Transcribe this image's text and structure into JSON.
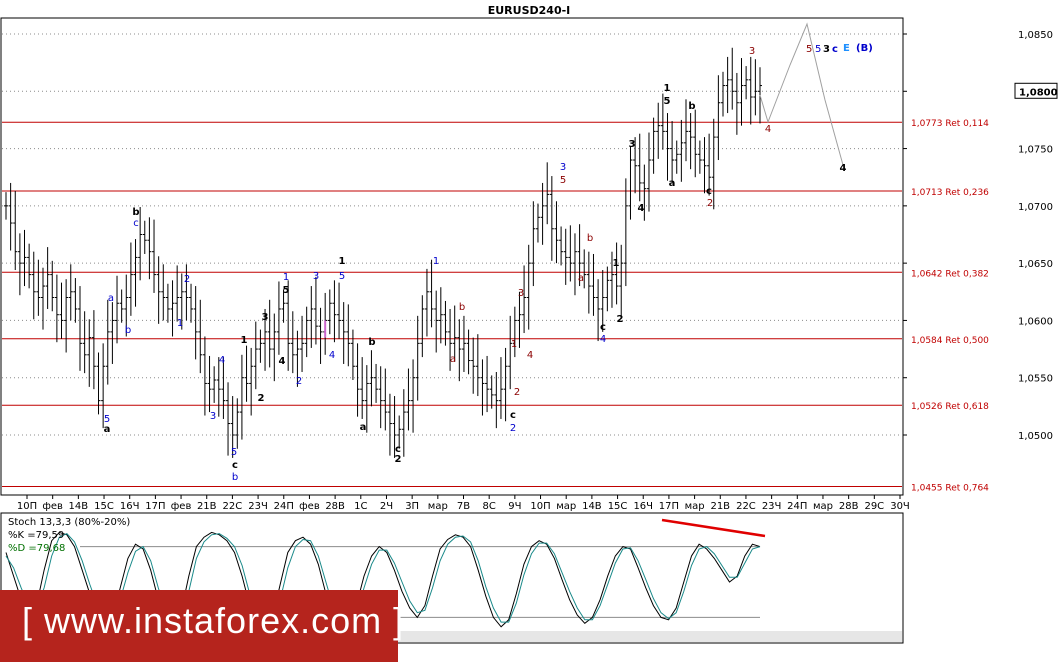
{
  "window": {
    "title": "EURUSD240-I"
  },
  "chart_data": [
    {
      "type": "line",
      "title": "EURUSD240-I",
      "ylim": [
        1.0435,
        1.0865
      ],
      "y_ticks": [
        "1,0850",
        "1,0800",
        "1,0750",
        "1,0700",
        "1,0650",
        "1,0600",
        "1,0550",
        "1,0500"
      ],
      "current_price": "1,0800",
      "x_ticks": [
        "10П",
        "фев",
        "14В",
        "15С",
        "16Ч",
        "17П",
        "фев",
        "21В",
        "22С",
        "23Ч",
        "24П",
        "фев",
        "28В",
        "1С",
        "2Ч",
        "3П",
        "мар",
        "7В",
        "8С",
        "9Ч",
        "10П",
        "мар",
        "14В",
        "15С",
        "16Ч",
        "17П",
        "мар",
        "21В",
        "22С",
        "23Ч",
        "24П",
        "мар",
        "28В",
        "29С",
        "30Ч"
      ],
      "retracements": [
        {
          "price": 1.0773,
          "label": "1,0773 Ret 0,114"
        },
        {
          "price": 1.0713,
          "label": "1,0713 Ret 0,236"
        },
        {
          "price": 1.0642,
          "label": "1,0642 Ret 0,382"
        },
        {
          "price": 1.0584,
          "label": "1,0584 Ret 0,500"
        },
        {
          "price": 1.0526,
          "label": "1,0526 Ret 0,618"
        },
        {
          "price": 1.0455,
          "label": "1,0455 Ret 0,764"
        }
      ],
      "series": [
        {
          "values": [
            1.07,
            1.0685,
            1.066,
            1.065,
            1.0655,
            1.064,
            1.0625,
            1.062,
            1.063,
            1.064,
            1.062,
            1.0605,
            1.06,
            1.062,
            1.0625,
            1.061,
            1.058,
            1.057,
            1.0585,
            1.056,
            1.053,
            1.056,
            1.059,
            1.06,
            1.0615,
            1.061,
            1.062,
            1.064,
            1.0655,
            1.0675,
            1.067,
            1.066,
            1.064,
            1.0625,
            1.062,
            1.061,
            1.0615,
            1.062,
            1.0625,
            1.062,
            1.061,
            1.059,
            1.057,
            1.0545,
            1.054,
            1.0548,
            1.054,
            1.053,
            1.051,
            1.05,
            1.052,
            1.055,
            1.0545,
            1.056,
            1.0575,
            1.058,
            1.059,
            1.0575,
            1.059,
            1.061,
            1.0615,
            1.058,
            1.057,
            1.0575,
            1.058,
            1.06,
            1.061,
            1.0595,
            1.059,
            1.06,
            1.0615,
            1.0605,
            1.06,
            1.059,
            1.058,
            1.056,
            1.054,
            1.053,
            1.0545,
            1.055,
            1.054,
            1.053,
            1.052,
            1.051,
            1.05,
            1.0505,
            1.052,
            1.053,
            1.055,
            1.058,
            1.061,
            1.0625,
            1.061,
            1.06,
            1.0605,
            1.059,
            1.058,
            1.0585,
            1.0575,
            1.058,
            1.0565,
            1.056,
            1.055,
            1.0545,
            1.054,
            1.0535,
            1.053,
            1.054,
            1.056,
            1.058,
            1.06,
            1.0605,
            1.062,
            1.065,
            1.068,
            1.069,
            1.07,
            1.071,
            1.068,
            1.067,
            1.066,
            1.0655,
            1.065,
            1.066,
            1.065,
            1.064,
            1.063,
            1.062,
            1.061,
            1.062,
            1.0635,
            1.064,
            1.063,
            1.065,
            1.07,
            1.074,
            1.0735,
            1.072,
            1.0715,
            1.074,
            1.0765,
            1.077,
            1.0765,
            1.075,
            1.074,
            1.0745,
            1.0755,
            1.0765,
            1.076,
            1.0745,
            1.074,
            1.0735,
            1.0725,
            1.076,
            1.079,
            1.0805,
            1.081,
            1.08,
            1.079,
            1.0805,
            1.081,
            1.0795,
            1.08,
            1.0805
          ]
        },
        {
          "name": "%K",
          "values": [
            75,
            55,
            35,
            22,
            30,
            60,
            85,
            92,
            90,
            80,
            60,
            40,
            25,
            15,
            20,
            45,
            70,
            82,
            78,
            60,
            35,
            18,
            12,
            25,
            55,
            80,
            88,
            92,
            90,
            85,
            75,
            55,
            30,
            15,
            10,
            20,
            48,
            75,
            85,
            88,
            82,
            65,
            40,
            18,
            8,
            12,
            30,
            55,
            72,
            80,
            75,
            60,
            42,
            28,
            20,
            30,
            55,
            78,
            86,
            90,
            88,
            80,
            60,
            38,
            20,
            12,
            18,
            40,
            65,
            80,
            85,
            82,
            70,
            52,
            35,
            22,
            15,
            20,
            35,
            55,
            72,
            80,
            78,
            62,
            45,
            30,
            20,
            18,
            28,
            50,
            72,
            82,
            78,
            70,
            60,
            50,
            55,
            72,
            82,
            80
          ]
        },
        {
          "name": "%D",
          "values": [
            72,
            62,
            45,
            30,
            28,
            45,
            72,
            88,
            91,
            84,
            68,
            48,
            30,
            18,
            18,
            35,
            58,
            76,
            80,
            68,
            45,
            25,
            14,
            20,
            42,
            70,
            84,
            90,
            91,
            87,
            80,
            64,
            40,
            22,
            12,
            16,
            35,
            62,
            80,
            86,
            85,
            72,
            50,
            28,
            12,
            10,
            22,
            45,
            65,
            77,
            77,
            66,
            50,
            34,
            24,
            26,
            45,
            68,
            82,
            88,
            89,
            84,
            68,
            46,
            28,
            16,
            16,
            32,
            56,
            74,
            83,
            83,
            74,
            58,
            42,
            28,
            18,
            18,
            30,
            48,
            66,
            78,
            79,
            68,
            52,
            36,
            24,
            19,
            24,
            42,
            64,
            78,
            80,
            74,
            64,
            54,
            54,
            66,
            78,
            80
          ]
        }
      ]
    }
  ],
  "indicator": {
    "title": "Stoch 13,3,3 (80%-20%)",
    "k_label": "%K =79,59",
    "d_label": "%D =79,68"
  },
  "waves": [
    {
      "t": "b",
      "c": "#000000",
      "i": [
        136,
        215
      ]
    },
    {
      "t": "c",
      "c": "#0000cc",
      "i": [
        136,
        226
      ]
    },
    {
      "t": "a",
      "c": "#0000cc",
      "i": [
        111,
        301
      ]
    },
    {
      "t": "b",
      "c": "#0000cc",
      "i": [
        128,
        333
      ]
    },
    {
      "t": "2",
      "c": "#0000cc",
      "i": [
        187,
        282
      ]
    },
    {
      "t": "1",
      "c": "#0000cc",
      "i": [
        180,
        326
      ]
    },
    {
      "t": "5",
      "c": "#0000cc",
      "i": [
        107,
        422
      ]
    },
    {
      "t": "a",
      "c": "#000000",
      "i": [
        107,
        432
      ]
    },
    {
      "t": "3",
      "c": "#0000cc",
      "i": [
        213,
        419
      ]
    },
    {
      "t": "4",
      "c": "#0000cc",
      "i": [
        222,
        363
      ]
    },
    {
      "t": "5",
      "c": "#0000cc",
      "i": [
        234,
        455
      ]
    },
    {
      "t": "c",
      "c": "#000000",
      "i": [
        235,
        468
      ]
    },
    {
      "t": "b",
      "c": "#0000cc",
      "i": [
        235,
        480
      ]
    },
    {
      "t": "1",
      "c": "#000000",
      "i": [
        244,
        343
      ]
    },
    {
      "t": "2",
      "c": "#000000",
      "i": [
        261,
        401
      ]
    },
    {
      "t": "3",
      "c": "#000000",
      "i": [
        265,
        320
      ]
    },
    {
      "t": "4",
      "c": "#000000",
      "i": [
        282,
        364
      ]
    },
    {
      "t": "1",
      "c": "#0000cc",
      "i": [
        286,
        280
      ]
    },
    {
      "t": "5",
      "c": "#000000",
      "i": [
        286,
        293
      ]
    },
    {
      "t": "2",
      "c": "#0000cc",
      "i": [
        299,
        384
      ]
    },
    {
      "t": "3",
      "c": "#0000cc",
      "i": [
        316,
        279
      ]
    },
    {
      "t": "4",
      "c": "#0000cc",
      "i": [
        332,
        358
      ]
    },
    {
      "t": "1",
      "c": "#000000",
      "i": [
        342,
        264
      ]
    },
    {
      "t": "5",
      "c": "#0000cc",
      "i": [
        342,
        279
      ]
    },
    {
      "t": "b",
      "c": "#000000",
      "i": [
        372,
        345
      ]
    },
    {
      "t": "a",
      "c": "#000000",
      "i": [
        363,
        430
      ]
    },
    {
      "t": "c",
      "c": "#000000",
      "i": [
        398,
        452
      ]
    },
    {
      "t": "2",
      "c": "#000000",
      "i": [
        398,
        462
      ]
    },
    {
      "t": "1",
      "c": "#0000cc",
      "i": [
        436,
        264
      ]
    },
    {
      "t": "b",
      "c": "#8b0000",
      "i": [
        462,
        310
      ]
    },
    {
      "t": "a",
      "c": "#8b0000",
      "i": [
        453,
        362
      ]
    },
    {
      "t": "3",
      "c": "#8b0000",
      "i": [
        521,
        296
      ]
    },
    {
      "t": "1",
      "c": "#8b0000",
      "i": [
        514,
        347
      ]
    },
    {
      "t": "4",
      "c": "#8b0000",
      "i": [
        530,
        358
      ]
    },
    {
      "t": "2",
      "c": "#8b0000",
      "i": [
        517,
        395
      ]
    },
    {
      "t": "c",
      "c": "#000000",
      "i": [
        513,
        418
      ]
    },
    {
      "t": "2",
      "c": "#0000cc",
      "i": [
        513,
        431
      ]
    },
    {
      "t": "3",
      "c": "#0000cc",
      "i": [
        563,
        170
      ]
    },
    {
      "t": "5",
      "c": "#8b0000",
      "i": [
        563,
        183
      ]
    },
    {
      "t": "b",
      "c": "#8b0000",
      "i": [
        590,
        241
      ]
    },
    {
      "t": "a",
      "c": "#8b0000",
      "i": [
        581,
        281
      ]
    },
    {
      "t": "1",
      "c": "#000000",
      "i": [
        616,
        266
      ]
    },
    {
      "t": "c",
      "c": "#000000",
      "i": [
        603,
        330
      ]
    },
    {
      "t": "2",
      "c": "#000000",
      "i": [
        620,
        322
      ]
    },
    {
      "t": "4",
      "c": "#0000cc",
      "i": [
        603,
        342
      ]
    },
    {
      "t": "3",
      "c": "#000000",
      "i": [
        632,
        147
      ]
    },
    {
      "t": "4",
      "c": "#000000",
      "i": [
        641,
        211
      ]
    },
    {
      "t": "1",
      "c": "#000000",
      "i": [
        667,
        91
      ]
    },
    {
      "t": "5",
      "c": "#000000",
      "i": [
        667,
        104
      ]
    },
    {
      "t": "b",
      "c": "#000000",
      "i": [
        692,
        109
      ]
    },
    {
      "t": "a",
      "c": "#000000",
      "i": [
        672,
        186
      ]
    },
    {
      "t": "c",
      "c": "#000000",
      "i": [
        709,
        194
      ]
    },
    {
      "t": "2",
      "c": "#8b0000",
      "i": [
        710,
        206
      ]
    },
    {
      "t": "3",
      "c": "#8b0000",
      "i": [
        752,
        54
      ]
    },
    {
      "t": "4",
      "c": "#8b0000",
      "i": [
        768,
        132
      ]
    },
    {
      "t": "4",
      "c": "#000000",
      "i": [
        843,
        171
      ]
    }
  ],
  "forecast_label": {
    "w5": "5",
    "w53": "5",
    "w3": "3",
    "wc": "c",
    "we": "E",
    "wb": "(B)"
  },
  "watermark": "[ www.instaforex.com ]"
}
